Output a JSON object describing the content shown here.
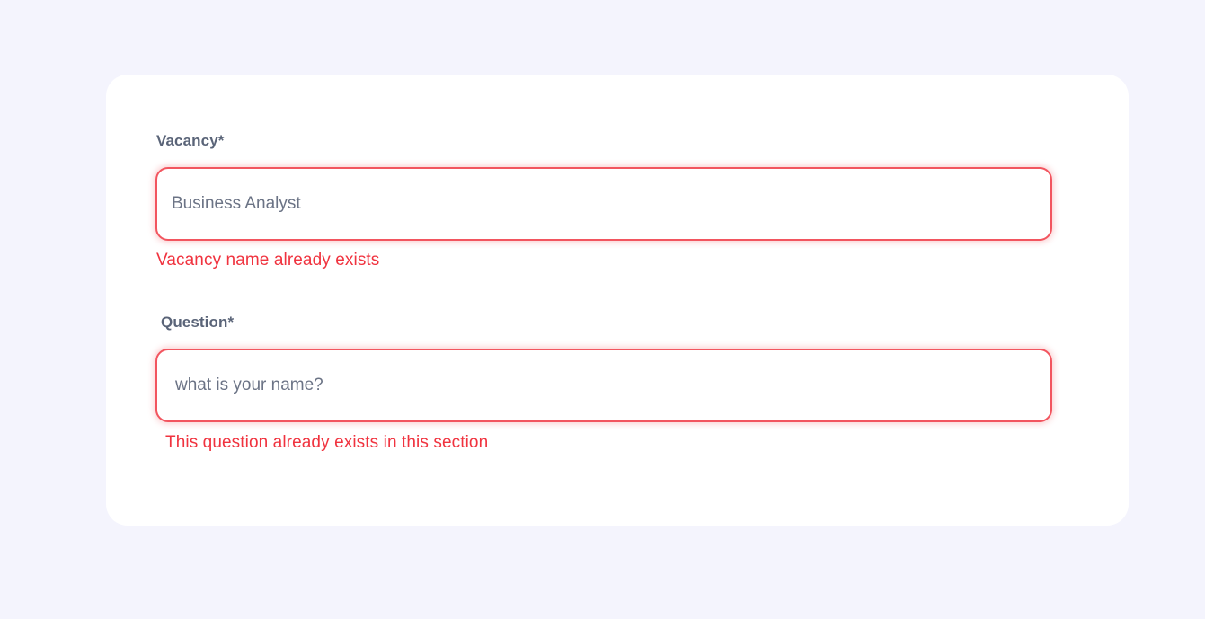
{
  "form": {
    "vacancy": {
      "label": "Vacancy*",
      "value": "Business Analyst",
      "error": "Vacancy name already exists"
    },
    "question": {
      "label": "Question*",
      "value": "what is your name?",
      "error": "This question already exists in this section"
    }
  },
  "colors": {
    "page_background": "#f4f4fd",
    "card_background": "#ffffff",
    "error": "#f0333f",
    "field_border_error": "#f2555f",
    "label": "#5a6478",
    "input_text": "#6b7385"
  }
}
